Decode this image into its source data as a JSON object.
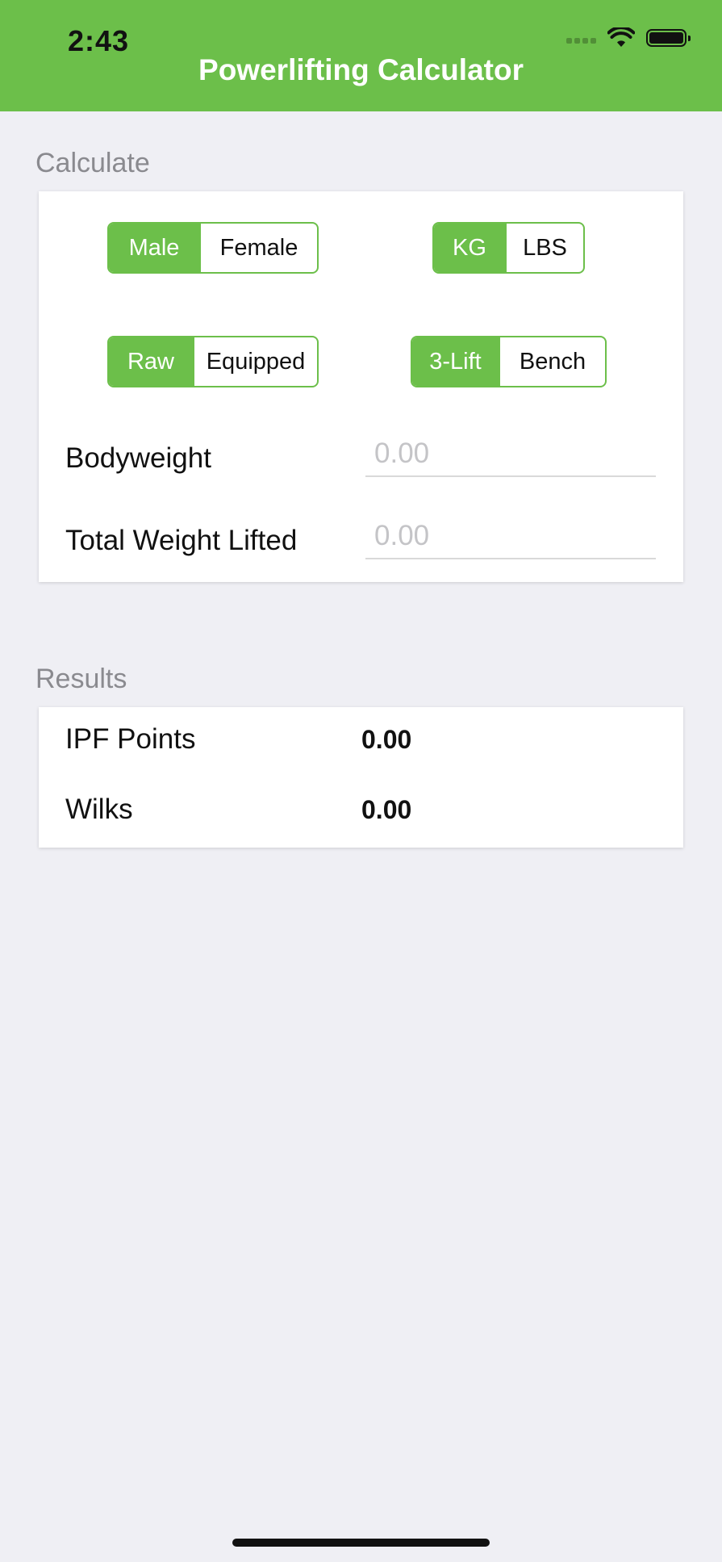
{
  "status_bar": {
    "time": "2:43"
  },
  "nav": {
    "title": "Powerlifting Calculator"
  },
  "calculate": {
    "section_label": "Calculate",
    "sex": {
      "options": [
        "Male",
        "Female"
      ],
      "selected": "Male"
    },
    "unit": {
      "options": [
        "KG",
        "LBS"
      ],
      "selected": "KG"
    },
    "division": {
      "options": [
        "Raw",
        "Equipped"
      ],
      "selected": "Raw"
    },
    "event": {
      "options": [
        "3-Lift",
        "Bench"
      ],
      "selected": "3-Lift"
    },
    "bodyweight": {
      "label": "Bodyweight",
      "value": "",
      "placeholder": "0.00"
    },
    "total": {
      "label": "Total Weight Lifted",
      "value": "",
      "placeholder": "0.00"
    }
  },
  "results": {
    "section_label": "Results",
    "ipf": {
      "label": "IPF Points",
      "value": "0.00"
    },
    "wilks": {
      "label": "Wilks",
      "value": "0.00"
    }
  },
  "colors": {
    "accent": "#6cbf4a",
    "background": "#efeff4"
  }
}
